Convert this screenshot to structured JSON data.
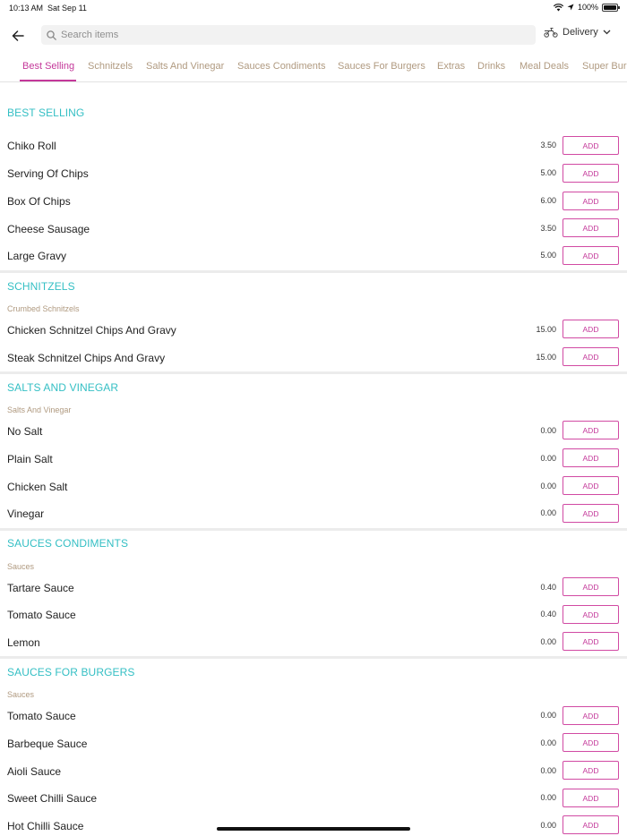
{
  "status": {
    "time": "10:13 AM",
    "date": "Sat Sep 11",
    "battery": "100%"
  },
  "header": {
    "search_placeholder": "Search items",
    "delivery_label": "Delivery"
  },
  "tabs": [
    {
      "label": "Best Selling",
      "active": true
    },
    {
      "label": "Schnitzels"
    },
    {
      "label": "Salts And Vinegar"
    },
    {
      "label": "Sauces Condiments"
    },
    {
      "label": "Sauces For Burgers"
    },
    {
      "label": "Extras"
    },
    {
      "label": "Drinks"
    },
    {
      "label": "Meal Deals"
    },
    {
      "label": "Super Burg"
    }
  ],
  "add_label": "ADD",
  "sections": [
    {
      "title": "BEST SELLING",
      "subtitle": "",
      "items": [
        {
          "name": "Chiko Roll",
          "price": "3.50"
        },
        {
          "name": "Serving Of Chips",
          "price": "5.00"
        },
        {
          "name": "Box Of Chips",
          "price": "6.00"
        },
        {
          "name": "Cheese Sausage",
          "price": "3.50"
        },
        {
          "name": "Large Gravy",
          "price": "5.00"
        }
      ]
    },
    {
      "title": "SCHNITZELS",
      "subtitle": "Crumbed Schnitzels",
      "items": [
        {
          "name": "Chicken Schnitzel Chips And Gravy",
          "price": "15.00"
        },
        {
          "name": "Steak Schnitzel Chips And Gravy",
          "price": "15.00"
        }
      ]
    },
    {
      "title": "SALTS AND VINEGAR",
      "subtitle": "Salts And Vinegar",
      "items": [
        {
          "name": "No Salt",
          "price": "0.00"
        },
        {
          "name": "Plain Salt",
          "price": "0.00"
        },
        {
          "name": "Chicken Salt",
          "price": "0.00"
        },
        {
          "name": "Vinegar",
          "price": "0.00"
        }
      ]
    },
    {
      "title": "SAUCES CONDIMENTS",
      "subtitle": "Sauces",
      "items": [
        {
          "name": "Tartare Sauce",
          "price": "0.40"
        },
        {
          "name": "Tomato Sauce",
          "price": "0.40"
        },
        {
          "name": "Lemon",
          "price": "0.00"
        }
      ]
    },
    {
      "title": "SAUCES FOR BURGERS",
      "subtitle": "Sauces",
      "items": [
        {
          "name": "Tomato Sauce",
          "price": "0.00"
        },
        {
          "name": "Barbeque Sauce",
          "price": "0.00"
        },
        {
          "name": "Aioli Sauce",
          "price": "0.00"
        },
        {
          "name": "Sweet Chilli Sauce",
          "price": "0.00"
        },
        {
          "name": "Hot Chilli Sauce",
          "price": "0.00"
        }
      ]
    }
  ]
}
